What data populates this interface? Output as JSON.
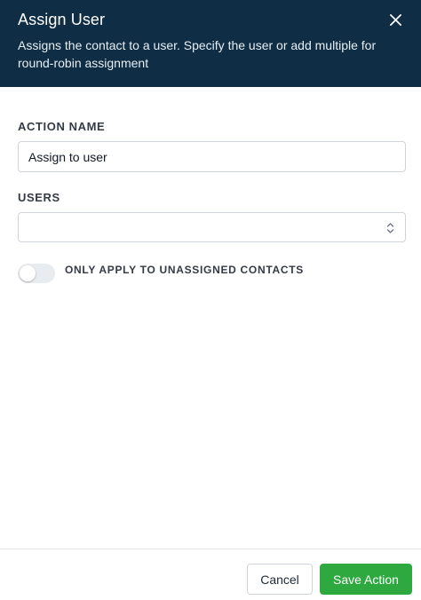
{
  "header": {
    "title": "Assign User",
    "description": "Assigns the contact to a user. Specify the user or add multiple for round-robin assignment",
    "close_icon": "close-icon"
  },
  "form": {
    "action_name_label": "ACTION NAME",
    "action_name_value": "Assign to user",
    "users_label": "USERS",
    "users_value": "",
    "toggle_label": "ONLY APPLY TO UNASSIGNED CONTACTS",
    "toggle_on": false
  },
  "footer": {
    "cancel_label": "Cancel",
    "save_label": "Save Action"
  },
  "colors": {
    "header_bg": "#0f2d44",
    "save_green": "#2da93f"
  }
}
